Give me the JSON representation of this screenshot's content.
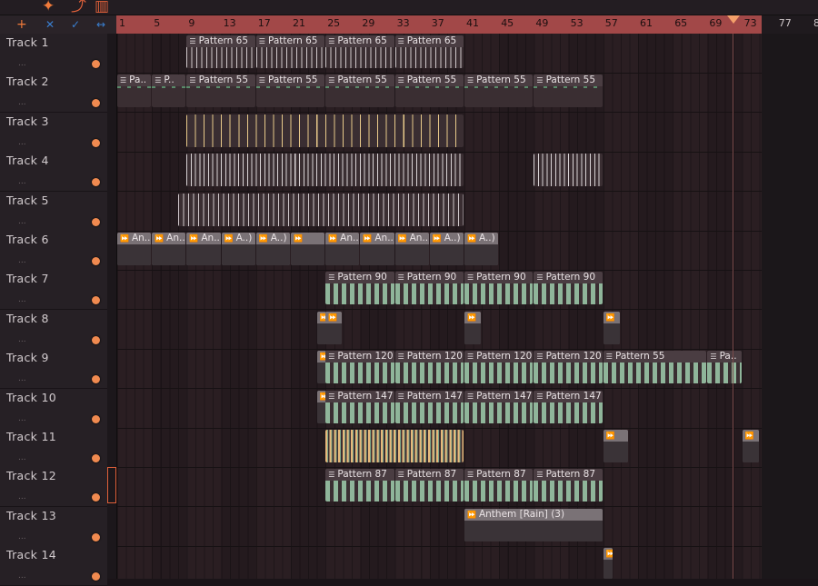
{
  "toolbar": {
    "icons": [
      "add-icon",
      "flame-icon",
      "curve-icon",
      "trash-icon"
    ]
  },
  "corner": {
    "add": "+",
    "x": "✕",
    "check": "✓",
    "arrow": "↔"
  },
  "ruler": {
    "ticks": [
      "1",
      "5",
      "9",
      "13",
      "17",
      "21",
      "25",
      "29",
      "33",
      "37",
      "41",
      "45",
      "49",
      "53",
      "57",
      "61",
      "65",
      "69",
      "73",
      "77",
      "8"
    ]
  },
  "tracks": [
    {
      "name": "Track 1",
      "dots": "..."
    },
    {
      "name": "Track 2",
      "dots": "..."
    },
    {
      "name": "Track 3",
      "dots": "..."
    },
    {
      "name": "Track 4",
      "dots": "..."
    },
    {
      "name": "Track 5",
      "dots": "..."
    },
    {
      "name": "Track 6",
      "dots": "..."
    },
    {
      "name": "Track 7",
      "dots": "..."
    },
    {
      "name": "Track 8",
      "dots": "..."
    },
    {
      "name": "Track 9",
      "dots": "..."
    },
    {
      "name": "Track 10",
      "dots": "..."
    },
    {
      "name": "Track 11",
      "dots": "..."
    },
    {
      "name": "Track 12",
      "dots": "..."
    },
    {
      "name": "Track 13",
      "dots": "..."
    },
    {
      "name": "Track 14",
      "dots": "..."
    }
  ],
  "clips": {
    "t1": [
      "Pattern 65",
      "Pattern 65",
      "Pattern 65",
      "Pattern 65"
    ],
    "t2": [
      "Pa..",
      "P..",
      "Pattern 55",
      "Pattern 55",
      "Pattern 55",
      "Pattern 55",
      "Pattern 55",
      "Pattern 55"
    ],
    "t6": [
      "An..)",
      "An..)",
      "An..)",
      "A..)",
      "A..)",
      "",
      "An..)",
      "An..)",
      "An..)",
      "A..)",
      "A..)"
    ],
    "t7": [
      "Pattern 90",
      "Pattern 90",
      "Pattern 90",
      "Pattern 90"
    ],
    "t9": [
      "Pattern 120",
      "Pattern 120",
      "Pattern 120",
      "Pattern 120",
      "Pattern 55",
      "Pa.."
    ],
    "t10": [
      "Pattern 147",
      "Pattern 147",
      "Pattern 147",
      "Pattern 147"
    ],
    "t12": [
      "Pattern 87",
      "Pattern 87",
      "Pattern 87",
      "Pattern 87"
    ],
    "t13": [
      "Anthem [Rain] (3)"
    ]
  },
  "colors": {
    "ruler": "#a24848",
    "accent": "#f08a50",
    "grid_dark": "#241a1e",
    "grid_light": "#2a1e22"
  }
}
